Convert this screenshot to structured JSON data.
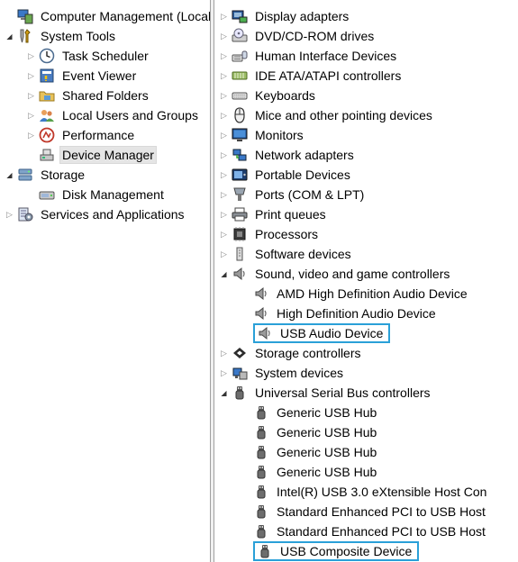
{
  "left_tree": [
    {
      "label": "Computer Management (Local",
      "icon": "computer-management-icon",
      "expander": "none",
      "depth": 0
    },
    {
      "label": "System Tools",
      "icon": "system-tools-icon",
      "expander": "open",
      "depth": 0
    },
    {
      "label": "Task Scheduler",
      "icon": "clock-icon",
      "expander": "closed",
      "depth": 1
    },
    {
      "label": "Event Viewer",
      "icon": "event-viewer-icon",
      "expander": "closed",
      "depth": 1
    },
    {
      "label": "Shared Folders",
      "icon": "shared-folder-icon",
      "expander": "closed",
      "depth": 1
    },
    {
      "label": "Local Users and Groups",
      "icon": "users-icon",
      "expander": "closed",
      "depth": 1
    },
    {
      "label": "Performance",
      "icon": "performance-icon",
      "expander": "closed",
      "depth": 1
    },
    {
      "label": "Device Manager",
      "icon": "device-manager-icon",
      "expander": "none",
      "depth": 1,
      "selected": true
    },
    {
      "label": "Storage",
      "icon": "storage-icon",
      "expander": "open",
      "depth": 0
    },
    {
      "label": "Disk Management",
      "icon": "disk-management-icon",
      "expander": "none",
      "depth": 1
    },
    {
      "label": "Services and Applications",
      "icon": "services-icon",
      "expander": "closed",
      "depth": 0
    }
  ],
  "device_tree": [
    {
      "label": "Display adapters",
      "icon": "display-adapter-icon",
      "expander": "closed",
      "depth": 0
    },
    {
      "label": "DVD/CD-ROM drives",
      "icon": "dvd-drive-icon",
      "expander": "closed",
      "depth": 0
    },
    {
      "label": "Human Interface Devices",
      "icon": "hid-icon",
      "expander": "closed",
      "depth": 0
    },
    {
      "label": "IDE ATA/ATAPI controllers",
      "icon": "ide-controller-icon",
      "expander": "closed",
      "depth": 0
    },
    {
      "label": "Keyboards",
      "icon": "keyboard-icon",
      "expander": "closed",
      "depth": 0
    },
    {
      "label": "Mice and other pointing devices",
      "icon": "mouse-icon",
      "expander": "closed",
      "depth": 0
    },
    {
      "label": "Monitors",
      "icon": "monitor-icon",
      "expander": "closed",
      "depth": 0
    },
    {
      "label": "Network adapters",
      "icon": "network-adapter-icon",
      "expander": "closed",
      "depth": 0
    },
    {
      "label": "Portable Devices",
      "icon": "portable-device-icon",
      "expander": "closed",
      "depth": 0
    },
    {
      "label": "Ports (COM & LPT)",
      "icon": "port-icon",
      "expander": "closed",
      "depth": 0
    },
    {
      "label": "Print queues",
      "icon": "printer-icon",
      "expander": "closed",
      "depth": 0
    },
    {
      "label": "Processors",
      "icon": "processor-icon",
      "expander": "closed",
      "depth": 0
    },
    {
      "label": "Software devices",
      "icon": "software-device-icon",
      "expander": "closed",
      "depth": 0
    },
    {
      "label": "Sound, video and game controllers",
      "icon": "speaker-icon",
      "expander": "open",
      "depth": 0
    },
    {
      "label": "AMD High Definition Audio Device",
      "icon": "speaker-icon",
      "expander": "none",
      "depth": 1
    },
    {
      "label": "High Definition Audio Device",
      "icon": "speaker-icon",
      "expander": "none",
      "depth": 1
    },
    {
      "label": "USB Audio Device",
      "icon": "speaker-icon",
      "expander": "none",
      "depth": 1,
      "highlighted": true
    },
    {
      "label": "Storage controllers",
      "icon": "storage-controller-icon",
      "expander": "closed",
      "depth": 0
    },
    {
      "label": "System devices",
      "icon": "system-device-icon",
      "expander": "closed",
      "depth": 0
    },
    {
      "label": "Universal Serial Bus controllers",
      "icon": "usb-icon",
      "expander": "open",
      "depth": 0
    },
    {
      "label": "Generic USB Hub",
      "icon": "usb-icon",
      "expander": "none",
      "depth": 1
    },
    {
      "label": "Generic USB Hub",
      "icon": "usb-icon",
      "expander": "none",
      "depth": 1
    },
    {
      "label": "Generic USB Hub",
      "icon": "usb-icon",
      "expander": "none",
      "depth": 1
    },
    {
      "label": "Generic USB Hub",
      "icon": "usb-icon",
      "expander": "none",
      "depth": 1
    },
    {
      "label": "Intel(R) USB 3.0 eXtensible Host Con",
      "icon": "usb-icon",
      "expander": "none",
      "depth": 1
    },
    {
      "label": "Standard Enhanced PCI to USB Host",
      "icon": "usb-icon",
      "expander": "none",
      "depth": 1
    },
    {
      "label": "Standard Enhanced PCI to USB Host",
      "icon": "usb-icon",
      "expander": "none",
      "depth": 1
    },
    {
      "label": "USB Composite Device",
      "icon": "usb-icon",
      "expander": "none",
      "depth": 1,
      "highlighted": true
    }
  ],
  "colors": {
    "highlight_border": "#2aa0d8",
    "selection_bg": "#e5e5e5"
  }
}
